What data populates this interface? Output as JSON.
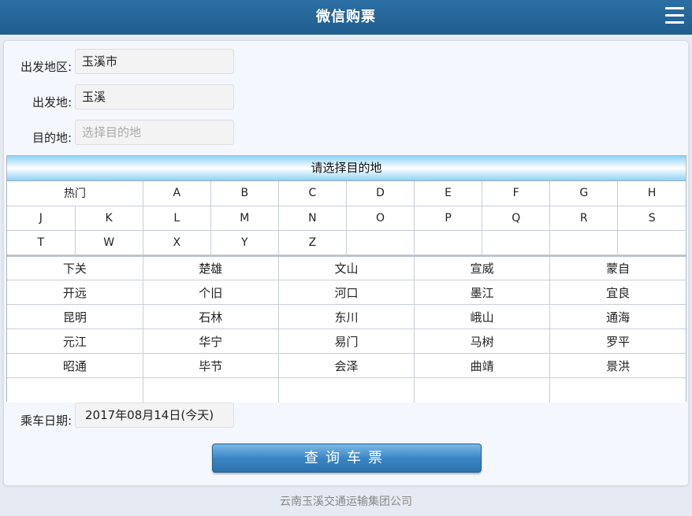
{
  "header": {
    "title": "微信购票",
    "menu_icon": "hamburger-menu-icon"
  },
  "form": {
    "departure_region_label": "出发地区:",
    "departure_region_value": "玉溪市",
    "departure_label": "出发地:",
    "departure_value": "玉溪",
    "destination_label": "目的地:",
    "destination_placeholder": "选择目的地",
    "date_label": "乘车日期:",
    "date_value": "2017年08月14日(今天)"
  },
  "picker": {
    "title": "请选择目的地",
    "letter_rows": [
      [
        "热门",
        "A",
        "B",
        "C",
        "D",
        "E",
        "F",
        "G",
        "H"
      ],
      [
        "J",
        "K",
        "L",
        "M",
        "N",
        "O",
        "P",
        "Q",
        "R",
        "S"
      ],
      [
        "T",
        "W",
        "X",
        "Y",
        "Z",
        "",
        "",
        "",
        "",
        ""
      ]
    ],
    "city_rows": [
      [
        "下关",
        "楚雄",
        "文山",
        "宣威",
        "蒙自"
      ],
      [
        "开远",
        "个旧",
        "河口",
        "墨江",
        "宜良"
      ],
      [
        "昆明",
        "石林",
        "东川",
        "峨山",
        "通海"
      ],
      [
        "元江",
        "华宁",
        "易门",
        "马树",
        "罗平"
      ],
      [
        "昭通",
        "毕节",
        "会泽",
        "曲靖",
        "景洪"
      ],
      [
        "",
        "",
        "",
        "",
        ""
      ]
    ]
  },
  "search_button": {
    "label": "查询车票"
  },
  "footer": {
    "text": "云南玉溪交通运输集团公司"
  },
  "colors": {
    "header": "#1f5d8f",
    "button": "#3b86c6",
    "picker_title": "#8ed3f5"
  }
}
